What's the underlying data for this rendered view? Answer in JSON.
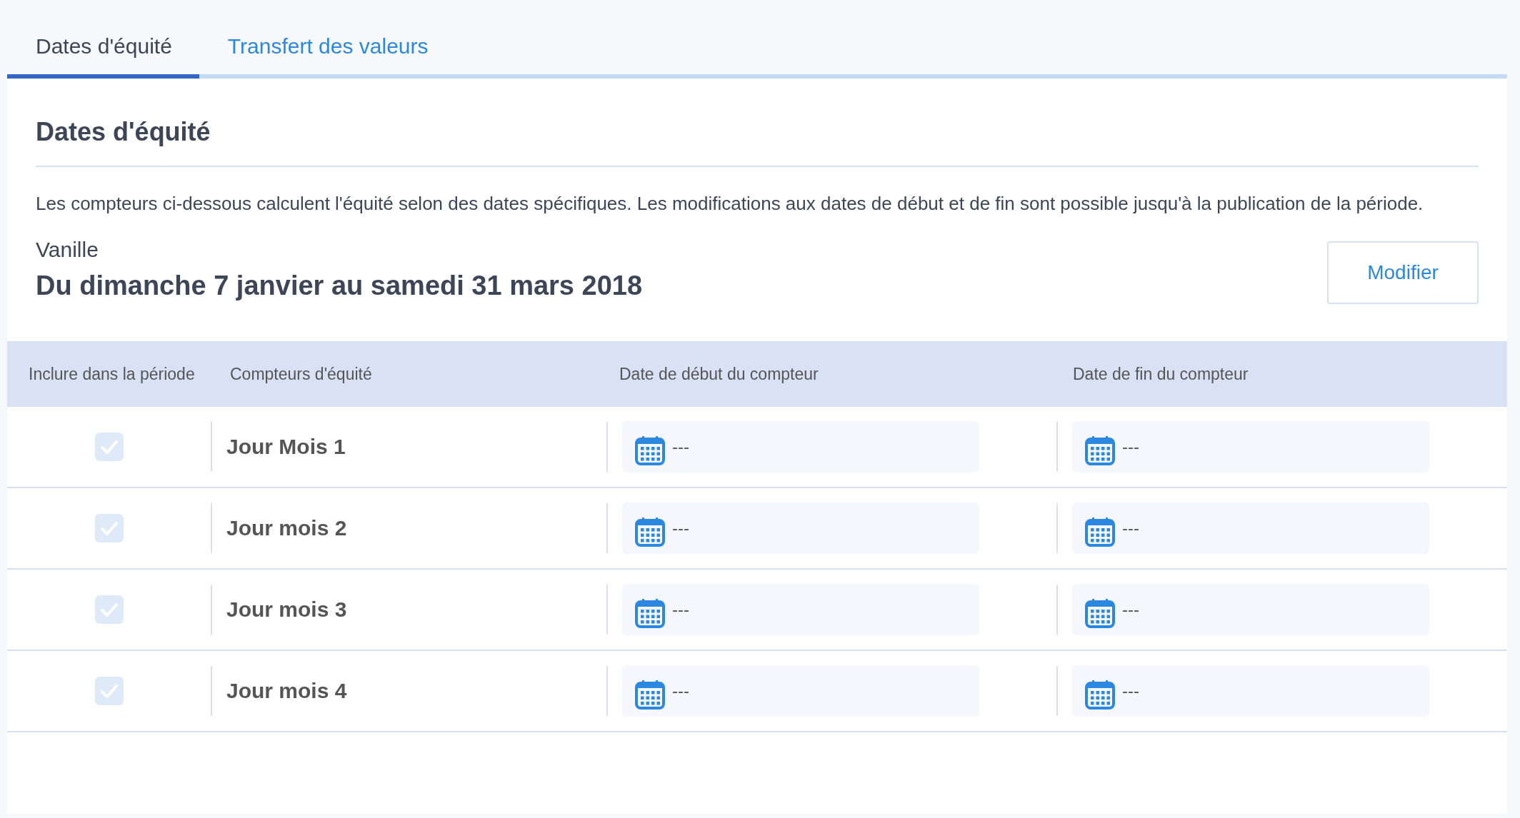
{
  "tabs": [
    {
      "label": "Dates d'équité",
      "selected": true
    },
    {
      "label": "Transfert des valeurs",
      "selected": false
    }
  ],
  "section": {
    "title": "Dates d'équité",
    "description": "Les compteurs ci-dessous calculent l'équité selon des dates spécifiques. Les modifications aux dates de début et de fin sont possible jusqu'à la publication de la période.",
    "period_name": "Vanille",
    "period_range": "Du dimanche 7 janvier au samedi 31 mars 2018",
    "edit_button": "Modifier"
  },
  "table": {
    "columns": [
      "Inclure dans la période",
      "Compteurs d'équité",
      "Date de début du compteur",
      "Date de fin du compteur"
    ],
    "rows": [
      {
        "checked": true,
        "name": "Jour Mois 1",
        "start": "---",
        "end": "---"
      },
      {
        "checked": true,
        "name": "Jour mois 2",
        "start": "---",
        "end": "---"
      },
      {
        "checked": true,
        "name": "Jour mois 3",
        "start": "---",
        "end": "---"
      },
      {
        "checked": true,
        "name": "Jour mois 4",
        "start": "---",
        "end": "---"
      }
    ]
  }
}
